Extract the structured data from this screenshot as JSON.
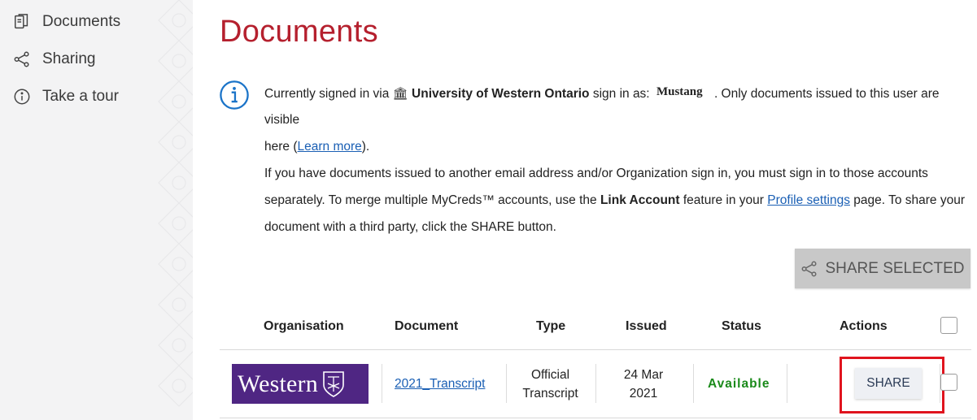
{
  "sidebar": {
    "items": [
      {
        "label": "Documents",
        "icon": "documents-icon"
      },
      {
        "label": "Sharing",
        "icon": "share-icon"
      },
      {
        "label": "Take a tour",
        "icon": "info-icon"
      }
    ]
  },
  "page": {
    "title": "Documents",
    "title_color": "#b5202e"
  },
  "info": {
    "l1_prefix": "Currently signed in via",
    "org_name": "University of Western Ontario",
    "sign_in_as": "sign in as:",
    "username": "Mustang",
    "l1_suffix": ". Only documents issued to this user are visible",
    "l2_prefix": "here (",
    "learn_more": "Learn more",
    "l2_suffix": ").",
    "l3": "If you have documents issued to another email address and/or Organization sign in, you must sign in to those accounts",
    "l4_prefix": "separately. To merge multiple MyCreds™ accounts, use the",
    "link_account": "Link Account",
    "l4_mid": "feature in your",
    "profile_settings": "Profile settings",
    "l4_suffix": "page. To share your",
    "l5": "document with a third party, click the SHARE button."
  },
  "toolbar": {
    "share_selected_label": "SHARE SELECTED"
  },
  "table": {
    "headers": [
      "Organisation",
      "Document",
      "Type",
      "Issued",
      "Status",
      "Actions"
    ],
    "rows": [
      {
        "organisation_logo_text": "Western",
        "document": "2021_Transcript",
        "type_line1": "Official",
        "type_line2": "Transcript",
        "issued_line1": "24 Mar",
        "issued_line2": "2021",
        "status": "Available",
        "action_label": "SHARE"
      }
    ]
  },
  "colors": {
    "status_available": "#1a8a1a",
    "link": "#1a5fb4",
    "western_purple": "#4f2683",
    "highlight": "#e0141e"
  }
}
